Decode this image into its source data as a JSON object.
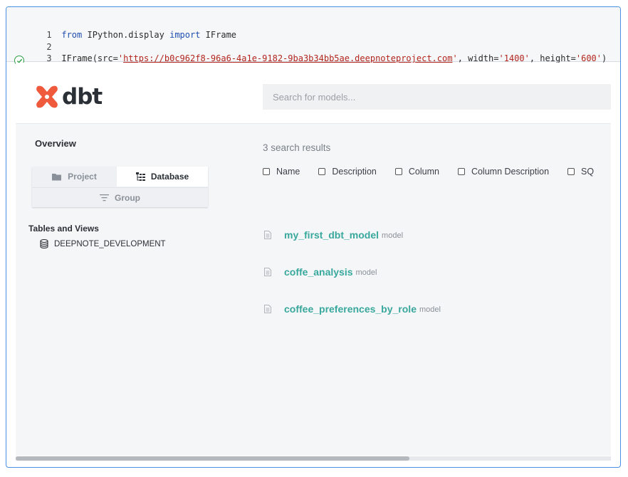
{
  "code": {
    "lines": [
      {
        "num": "1",
        "kw1": "from",
        "module": " IPython.display ",
        "kw2": "import",
        "name": " IFrame"
      },
      {
        "num": "2"
      },
      {
        "num": "3",
        "call": "IFrame(src=",
        "url_q1": "'",
        "url": "https://b0c962f8-96a6-4a1e-9182-9ba3b34bb5ae.deepnoteproject.com",
        "url_q2": "'",
        "sep1": ", width=",
        "width": "'1400'",
        "sep2": ", height=",
        "height": "'600'",
        "close": ")"
      }
    ]
  },
  "dbt": {
    "logo_text": "dbt",
    "search_placeholder": "Search for models...",
    "sidebar": {
      "overview": "Overview",
      "tabs": {
        "project": "Project",
        "database": "Database",
        "group": "Group"
      },
      "tables_title": "Tables and Views",
      "database_name": "DEEPNOTE_DEVELOPMENT"
    },
    "main": {
      "results_count": "3 search results",
      "filters": [
        "Name",
        "Description",
        "Column",
        "Column Description",
        "SQ"
      ],
      "results": [
        {
          "name": "my_first_dbt_model",
          "type": "model"
        },
        {
          "name": "coffe_analysis",
          "type": "model"
        },
        {
          "name": "coffee_preferences_by_role",
          "type": "model"
        }
      ]
    }
  },
  "colors": {
    "accent": "#38a89d",
    "logo": "#ef5a3c",
    "cell_border": "#4a90e2",
    "success": "#2f9e44"
  }
}
